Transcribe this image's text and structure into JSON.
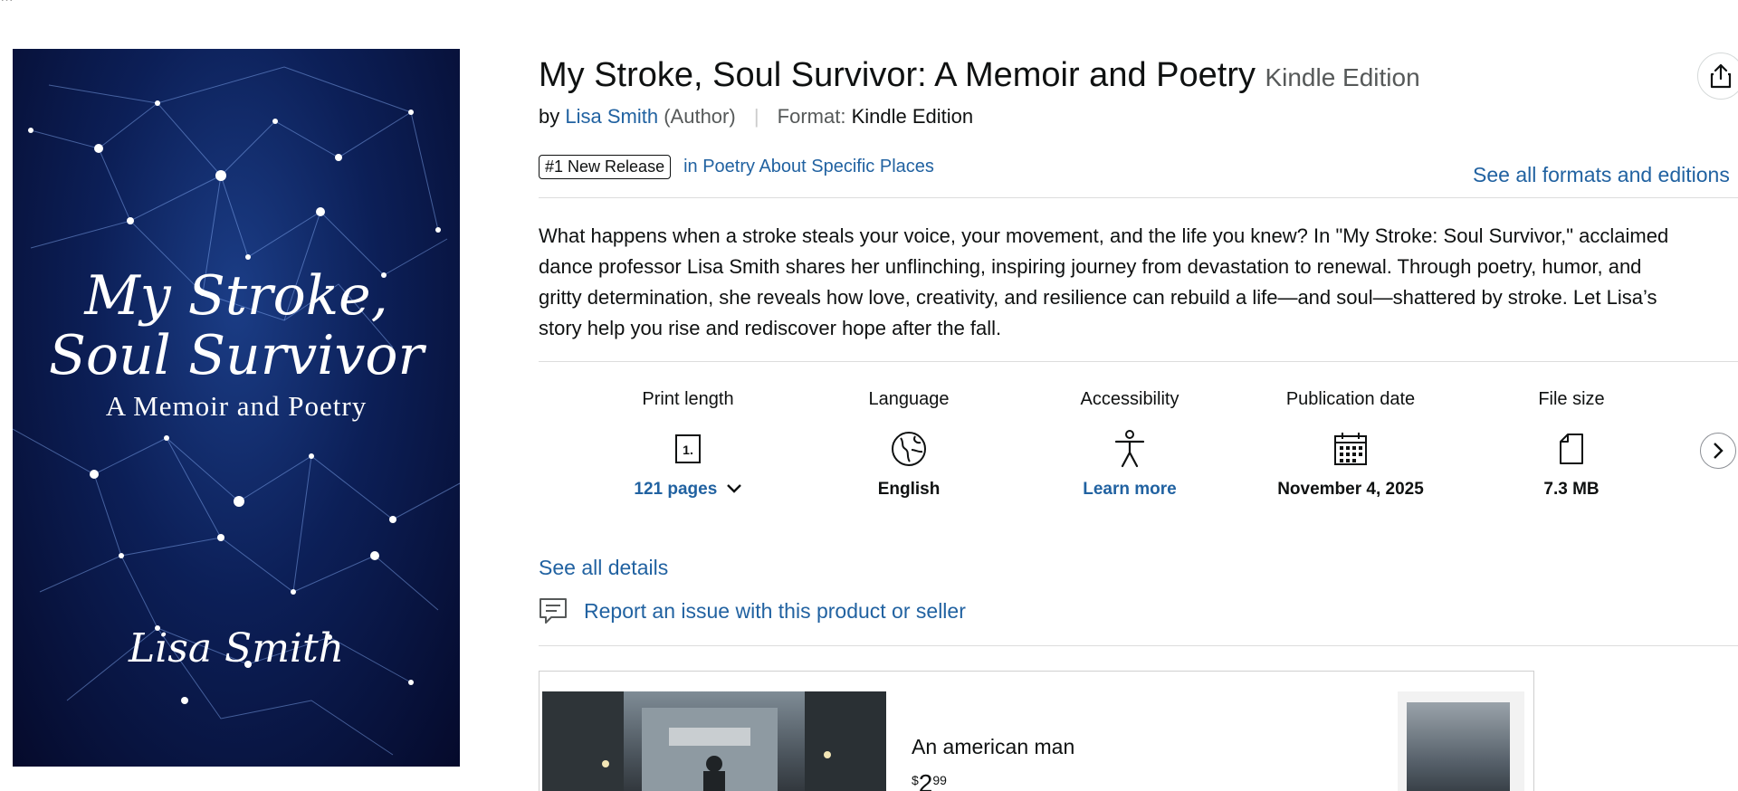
{
  "top_crumb": "…",
  "cover": {
    "title_line1": "My Stroke,",
    "title_line2": "Soul Survivor",
    "subtitle": "A Memoir and Poetry",
    "author": "Lisa Smith"
  },
  "product": {
    "title": "My Stroke, Soul Survivor: A Memoir and Poetry",
    "edition": "Kindle Edition",
    "by_prefix": "by",
    "author": "Lisa Smith",
    "author_role": "(Author)",
    "format_label": "Format:",
    "format_value": "Kindle Edition",
    "badge": "#1 New Release",
    "badge_category": "in Poetry About Specific Places",
    "formats_link": "See all formats and editions",
    "description": "What happens when a stroke steals your voice, your movement, and the life you knew? In \"My Stroke: Soul Survivor,\" acclaimed dance professor Lisa Smith shares her unflinching, inspiring journey from devastation to renewal. Through poetry, humor, and gritty determination, she reveals how love, creativity, and resilience can rebuild a life—and soul—shattered by stroke. Let Lisa’s story help you rise and rediscover hope after the fall."
  },
  "details": [
    {
      "label": "Print length",
      "icon": "page-count-icon",
      "value": "121 pages",
      "link": true
    },
    {
      "label": "Language",
      "icon": "globe-icon",
      "value": "English",
      "link": false
    },
    {
      "label": "Accessibility",
      "icon": "accessibility-icon",
      "value": "Learn more",
      "link": true
    },
    {
      "label": "Publication date",
      "icon": "calendar-icon",
      "value": "November 4, 2025",
      "link": false
    },
    {
      "label": "File size",
      "icon": "file-icon",
      "value": "7.3 MB",
      "link": false
    }
  ],
  "see_all_details": "See all details",
  "report_issue": "Report an issue with this product or seller",
  "ad": {
    "title": "An american man",
    "price_symbol": "$",
    "price_whole": "2",
    "price_fraction": "99"
  },
  "colors": {
    "link": "#2162a1",
    "text": "#0f1111",
    "muted": "#565959",
    "cover_bg": "#0c1f57"
  }
}
